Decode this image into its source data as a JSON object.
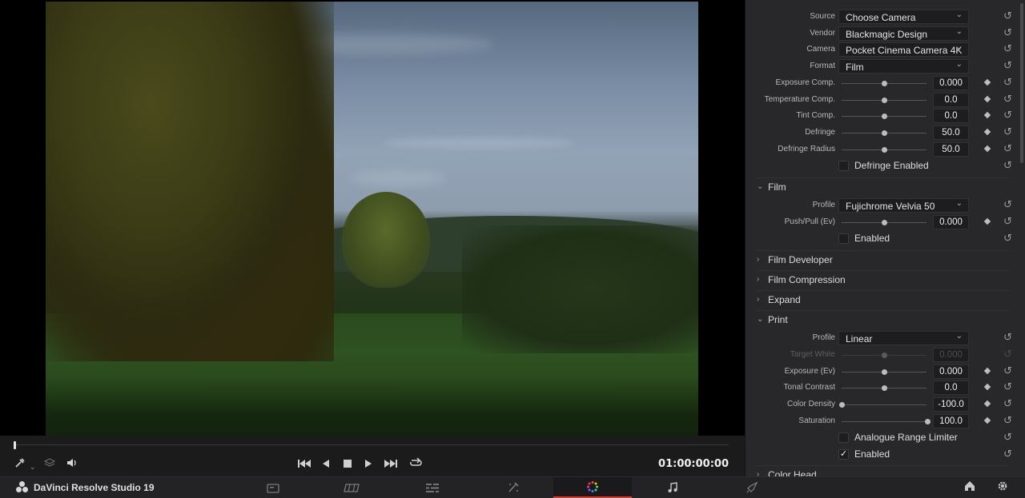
{
  "app": {
    "name": "DaVinci Resolve Studio 19"
  },
  "transport": {
    "timecode": "01:00:00:00"
  },
  "pages": [
    {
      "name": "Media",
      "icon": "media-page-icon",
      "active": false
    },
    {
      "name": "Cut",
      "icon": "cut-page-icon",
      "active": false
    },
    {
      "name": "Edit",
      "icon": "edit-page-icon",
      "active": false
    },
    {
      "name": "Fusion",
      "icon": "fusion-page-icon",
      "active": false
    },
    {
      "name": "Color",
      "icon": "color-page-icon",
      "active": true
    },
    {
      "name": "Fairlight",
      "icon": "fairlight-page-icon",
      "active": false
    },
    {
      "name": "Deliver",
      "icon": "deliver-page-icon",
      "active": false
    }
  ],
  "inspector": {
    "source": {
      "label": "Source",
      "value": "Choose Camera"
    },
    "vendor": {
      "label": "Vendor",
      "value": "Blackmagic Design"
    },
    "camera": {
      "label": "Camera",
      "value": "Pocket Cinema Camera 4K"
    },
    "format": {
      "label": "Format",
      "value": "Film"
    },
    "exposure_comp": {
      "label": "Exposure Comp.",
      "value": "0.000"
    },
    "temperature_comp": {
      "label": "Temperature Comp.",
      "value": "0.0"
    },
    "tint_comp": {
      "label": "Tint Comp.",
      "value": "0.0"
    },
    "defringe": {
      "label": "Defringe",
      "value": "50.0"
    },
    "defringe_radius": {
      "label": "Defringe Radius",
      "value": "50.0"
    },
    "defringe_enabled": {
      "label": "Defringe Enabled",
      "checked": false
    },
    "film_section": {
      "title": "Film",
      "expanded": true
    },
    "film_profile": {
      "label": "Profile",
      "value": "Fujichrome Velvia 50"
    },
    "push_pull": {
      "label": "Push/Pull (Ev)",
      "value": "0.000"
    },
    "film_enabled": {
      "label": "Enabled",
      "checked": false
    },
    "film_developer": {
      "title": "Film Developer",
      "expanded": false
    },
    "film_compression": {
      "title": "Film Compression",
      "expanded": false
    },
    "expand": {
      "title": "Expand",
      "expanded": false
    },
    "print_section": {
      "title": "Print",
      "expanded": true
    },
    "print_profile": {
      "label": "Profile",
      "value": "Linear"
    },
    "target_white": {
      "label": "Target White",
      "value": "0.000"
    },
    "print_exposure": {
      "label": "Exposure (Ev)",
      "value": "0.000"
    },
    "tonal_contrast": {
      "label": "Tonal Contrast",
      "value": "0.0"
    },
    "color_density": {
      "label": "Color Density",
      "value": "-100.0"
    },
    "saturation": {
      "label": "Saturation",
      "value": "100.0"
    },
    "analogue_range_limiter": {
      "label": "Analogue Range Limiter",
      "checked": false
    },
    "print_enabled": {
      "label": "Enabled",
      "checked": true
    },
    "color_head": {
      "title": "Color Head",
      "expanded": false
    }
  },
  "colors": {
    "accent": "#d33a2c",
    "panel": "#28282a",
    "viewer_bg": "#000000"
  }
}
